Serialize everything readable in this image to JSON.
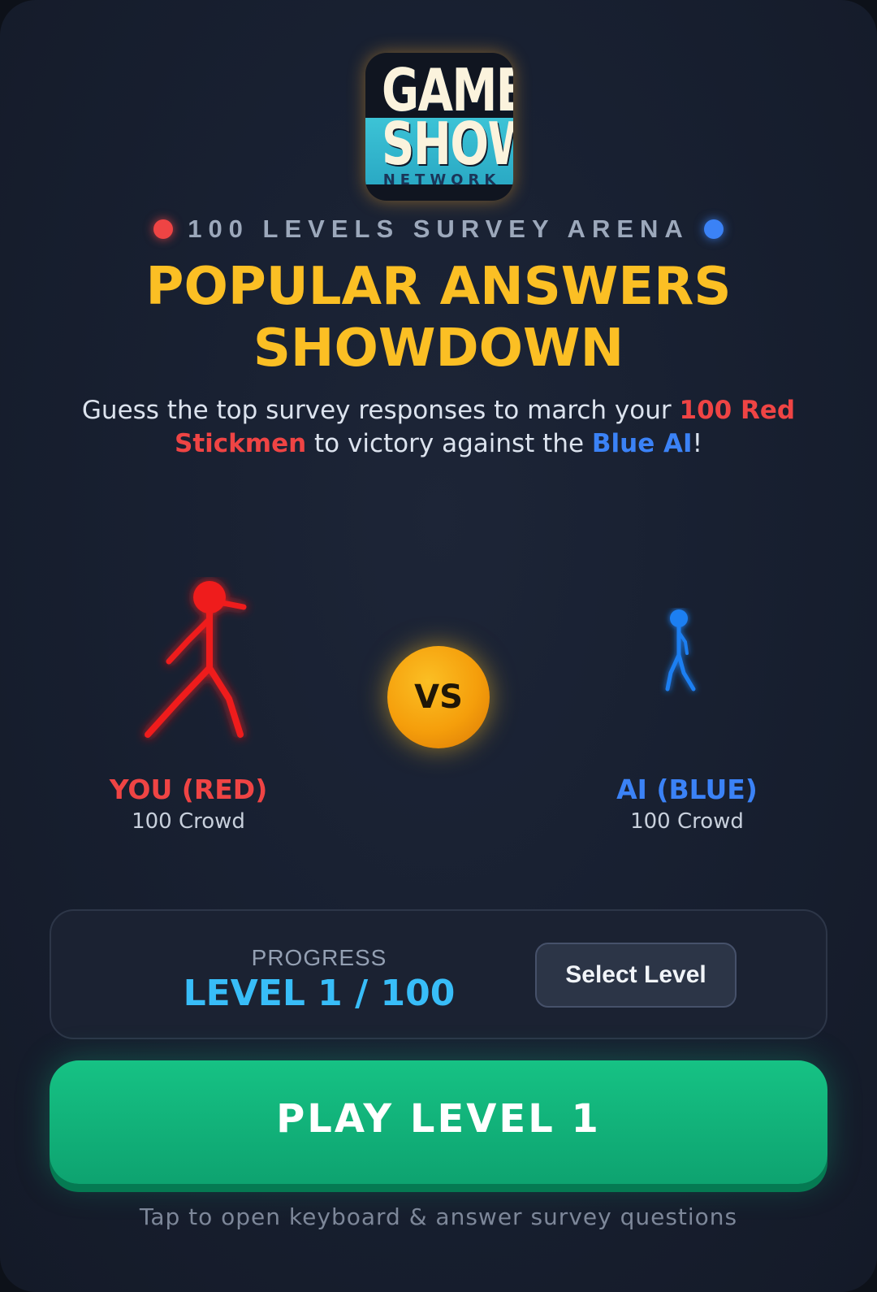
{
  "logo": {
    "line1": "GAME",
    "line2": "SHOW",
    "line3": "NETWORK"
  },
  "header": {
    "arena_label": "100 LEVELS SURVEY ARENA",
    "title_line1": "POPULAR ANSWERS",
    "title_line2": "SHOWDOWN",
    "subtitle_part1": "Guess the top survey responses to march your ",
    "subtitle_red": "100 Red Stickmen",
    "subtitle_part2": " to victory against the ",
    "subtitle_blue": "Blue AI",
    "subtitle_part3": "!"
  },
  "arena": {
    "vs_label": "VS",
    "player": {
      "label": "YOU (RED)",
      "crowd": "100 Crowd",
      "color": "#ef1c1c"
    },
    "ai": {
      "label": "AI (BLUE)",
      "crowd": "100 Crowd",
      "color": "#1d7ff2"
    }
  },
  "progress": {
    "label": "PROGRESS",
    "value": "LEVEL 1 / 100",
    "select_level_label": "Select Level"
  },
  "play_button": {
    "label": "PLAY LEVEL 1"
  },
  "hint": "Tap to open keyboard & answer survey questions",
  "colors": {
    "accent_yellow": "#fbbf24",
    "accent_red": "#ef4444",
    "accent_blue": "#3b82f6",
    "accent_cyan": "#38bdf8",
    "play_green": "#10b981",
    "background": "#182031"
  }
}
